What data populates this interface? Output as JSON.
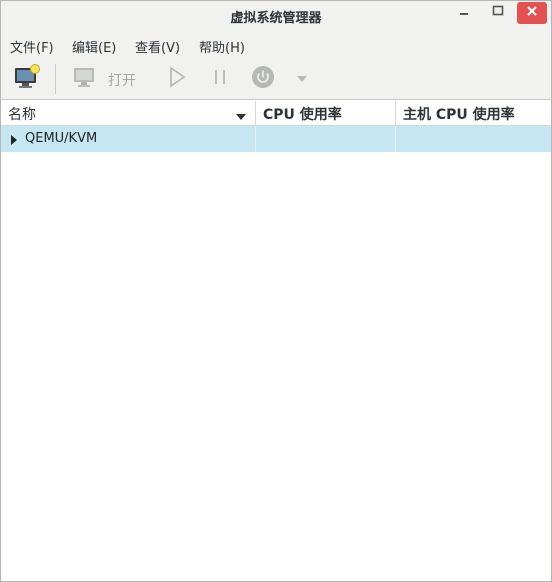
{
  "window": {
    "title": "虚拟系统管理器"
  },
  "menubar": {
    "items": [
      "文件(F)",
      "编辑(E)",
      "查看(V)",
      "帮助(H)"
    ]
  },
  "toolbar": {
    "open_label": "打开",
    "icons": [
      "new-vm-icon",
      "monitor-icon",
      "play-icon",
      "pause-icon",
      "power-icon",
      "dropdown-arrow-icon"
    ]
  },
  "table": {
    "columns": [
      "名称",
      "CPU 使用率",
      "主机 CPU 使用率"
    ],
    "rows": [
      {
        "name": "QEMU/KVM",
        "cpu": "",
        "host_cpu": ""
      }
    ]
  },
  "colors": {
    "selected_row": "#c6e6f2",
    "close_button": "#e25252",
    "chrome": "#f1f1f0"
  }
}
